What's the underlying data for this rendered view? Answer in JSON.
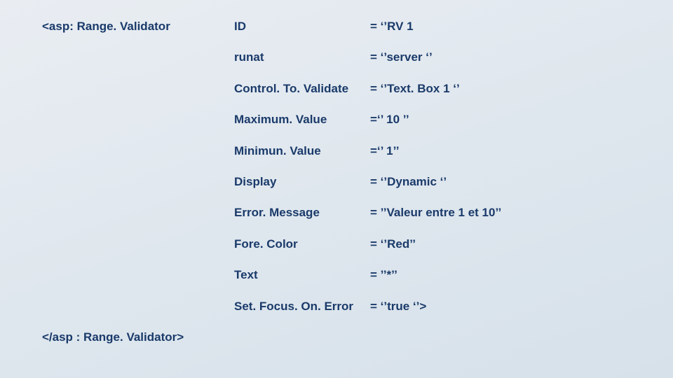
{
  "open_tag": "<asp: Range. Validator",
  "close_tag": "</asp : Range. Validator>",
  "rows": [
    {
      "attr": "ID",
      "val": "= ‘’RV 1"
    },
    {
      "attr": "runat",
      "val": "= ‘’server ‘’"
    },
    {
      "attr": "Control. To. Validate",
      "val": "= ‘’Text. Box 1 ‘’"
    },
    {
      "attr": "Maximum. Value",
      "val": "=‘’ 10 ’’"
    },
    {
      "attr": "Minimun. Value",
      "val": "=‘’ 1’’"
    },
    {
      "attr": "Display",
      "val": "= ‘’Dynamic ‘’"
    },
    {
      "attr": "Error. Message",
      "val": "=  ’’Valeur entre 1 et 10’’"
    },
    {
      "attr": "Fore. Color",
      "val": "= ‘’Red’’"
    },
    {
      "attr": "Text",
      "val": "= ’’*’’"
    },
    {
      "attr": "Set. Focus. On. Error",
      "val": "= ‘’true ‘’>"
    }
  ]
}
